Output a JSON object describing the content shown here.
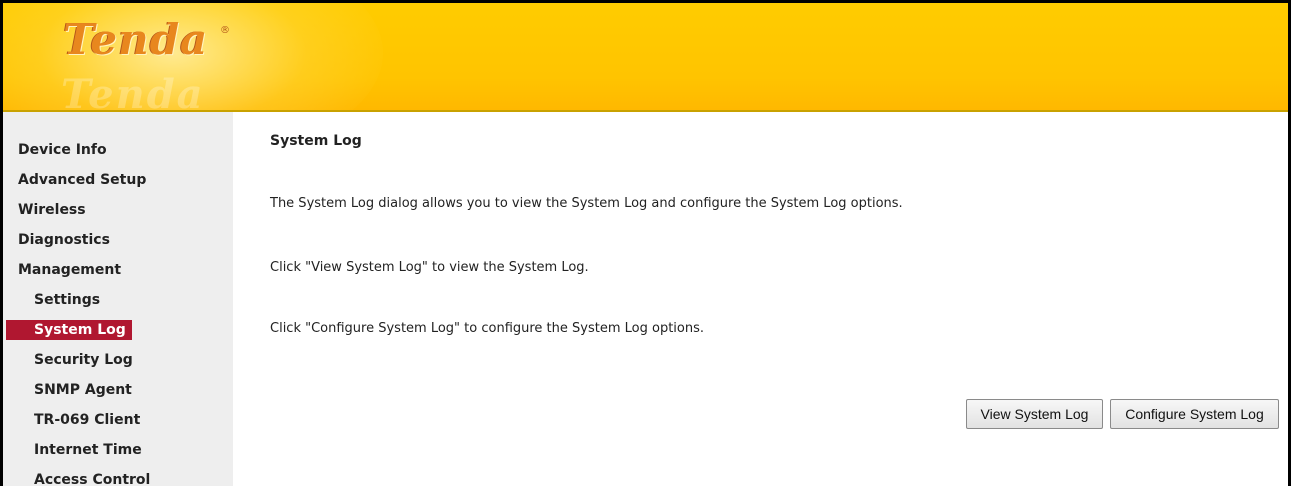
{
  "brand": {
    "logo": "Tenda",
    "reg": "®"
  },
  "sidebar": {
    "items": [
      {
        "label": "Device Info",
        "level": 0,
        "active": false
      },
      {
        "label": "Advanced Setup",
        "level": 0,
        "active": false
      },
      {
        "label": "Wireless",
        "level": 0,
        "active": false
      },
      {
        "label": "Diagnostics",
        "level": 0,
        "active": false
      },
      {
        "label": "Management",
        "level": 0,
        "active": false
      },
      {
        "label": "Settings",
        "level": 1,
        "active": false
      },
      {
        "label": "System Log",
        "level": 1,
        "active": true
      },
      {
        "label": "Security Log",
        "level": 1,
        "active": false
      },
      {
        "label": "SNMP Agent",
        "level": 1,
        "active": false
      },
      {
        "label": "TR-069 Client",
        "level": 1,
        "active": false
      },
      {
        "label": "Internet Time",
        "level": 1,
        "active": false
      },
      {
        "label": "Access Control",
        "level": 1,
        "active": false
      }
    ]
  },
  "main": {
    "title": "System Log",
    "paragraphs": [
      "The System Log dialog allows you to view the System Log and configure the System Log options.",
      "Click \"View System Log\" to view the System Log.",
      "Click \"Configure System Log\" to configure the System Log options."
    ],
    "buttons": {
      "view": "View System Log",
      "configure": "Configure System Log"
    }
  },
  "colors": {
    "banner": "#ffcc00",
    "logo": "#e8871e",
    "sidebar_bg": "#eeeeee",
    "active_item": "#b01730"
  }
}
